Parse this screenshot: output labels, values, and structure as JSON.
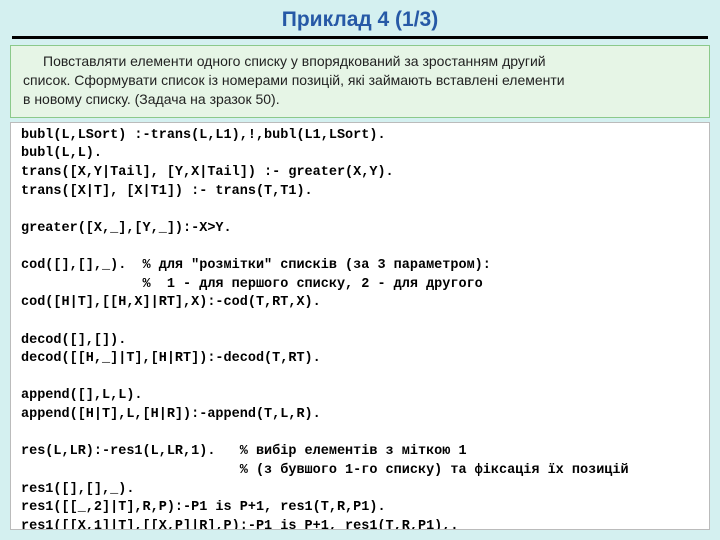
{
  "title": "Приклад 4   (1/3)",
  "problem": {
    "line1": "Повставляти елементи одного списку у впорядкований за зростанням другий",
    "line2": "список. Сформувати список із номерами позицій, які займають вставлені елементи",
    "line3": "в новому списку. (Задача на зразок 50)."
  },
  "code": "bubl(L,LSort) :-trans(L,L1),!,bubl(L1,LSort).\nbubl(L,L).\ntrans([X,Y|Tail], [Y,X|Tail]) :- greater(X,Y).\ntrans([X|T], [X|T1]) :- trans(T,T1).\n\ngreater([X,_],[Y,_]):-X>Y.\n\ncod([],[],_).  % для \"розмітки\" списків (за 3 параметром):\n               %  1 - для першого списку, 2 - для другого\ncod([H|T],[[H,X]|RT],X):-cod(T,RT,X).\n\ndecod([],[]).\ndecod([[H,_]|T],[H|RT]):-decod(T,RT).\n\nappend([],L,L).\nappend([H|T],L,[H|R]):-append(T,L,R).\n\nres(L,LR):-res1(L,LR,1).   % вибір елементів з міткою 1\n                           % (з бувшого 1-го списку) та фіксація їх позицій\nres1([],[],_).\nres1([[_,2]|T],R,P):-P1 is P+1, res1(T,R,P1).\nres1([[X,1]|T],[[X,P]|R],P):-P1 is P+1, res1(T,R,P1),."
}
